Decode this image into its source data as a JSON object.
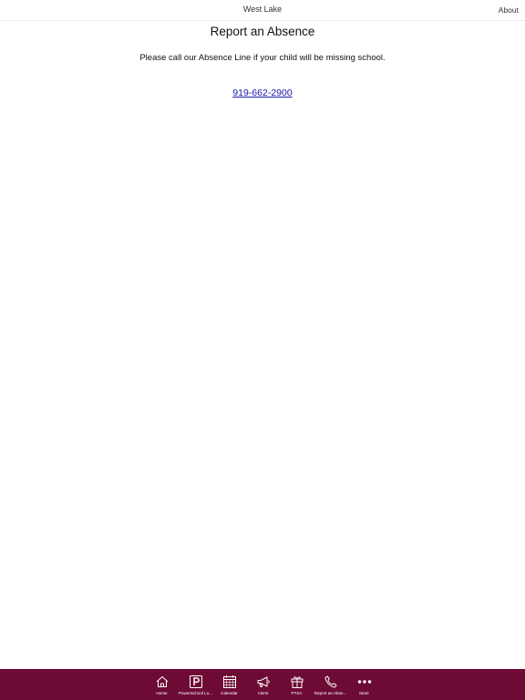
{
  "header": {
    "title": "West Lake",
    "about_label": "About"
  },
  "main": {
    "title": "Report an Absence",
    "message": "Please call our Absence Line if your child will be missing school.",
    "phone": "919-662-2900"
  },
  "tab_bar": {
    "background_color": "#6e0b35",
    "icon_color": "#ffffff",
    "tabs": [
      {
        "label": "Home",
        "icon": "home-icon"
      },
      {
        "label": "PowerSchool Lo...",
        "icon": "powerschool-icon"
      },
      {
        "label": "Calendar",
        "icon": "calendar-icon"
      },
      {
        "label": "Alerts",
        "icon": "megaphone-icon"
      },
      {
        "label": "PTSA",
        "icon": "gift-icon"
      },
      {
        "label": "Report an Abse...",
        "icon": "phone-icon"
      },
      {
        "label": "More",
        "icon": "more-icon"
      }
    ]
  }
}
